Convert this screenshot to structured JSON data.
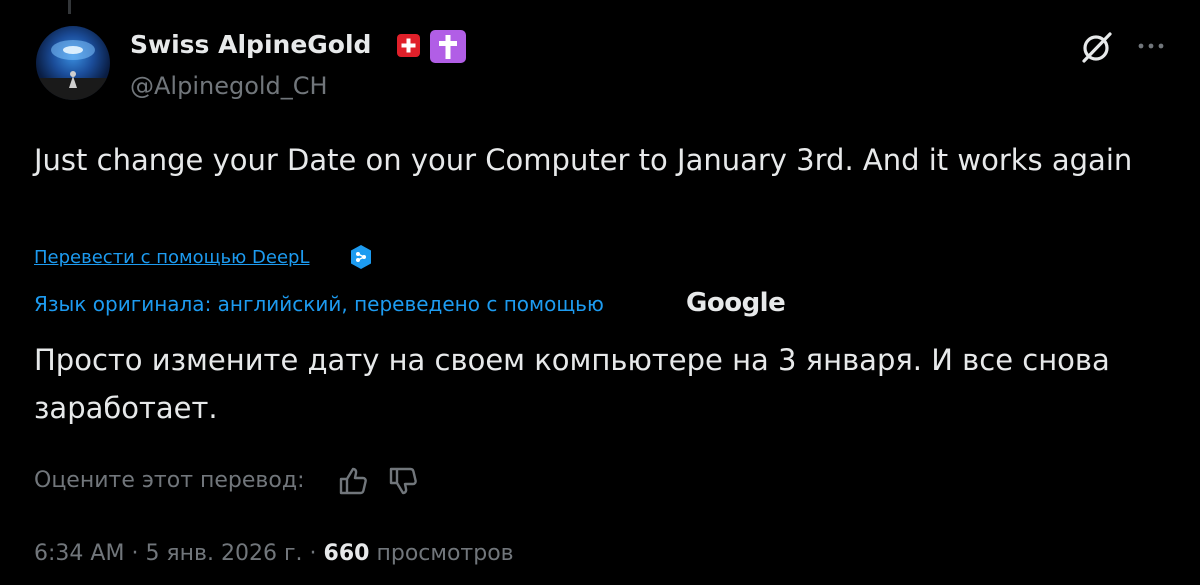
{
  "tweet": {
    "author": {
      "display_name": "Swiss AlpineGold",
      "handle": "@Alpinegold_CH",
      "flag_emoji": "swiss-flag-icon",
      "cross_emoji": "latin-cross-icon"
    },
    "text": "Just change your Date on your Computer to January 3rd. And it works again",
    "translate_link": "Перевести с помощью DeepL",
    "translation": {
      "source_label": "Язык оригинала: английский, переведено с помощью",
      "provider": "Google",
      "text": "Просто измените дату на своем компьютере на 3 января. И все снова заработает."
    },
    "rate": {
      "label": "Оцените этот перевод:"
    },
    "meta": {
      "time": "6:34 AM",
      "separator": "·",
      "date": "5 янв. 2026 г.",
      "views": "660",
      "views_label": "просмотров"
    }
  },
  "colors": {
    "background": "#000000",
    "text_primary": "#e7e9ea",
    "text_secondary": "#71767b",
    "link": "#1d9bf0",
    "flag_red": "#e0202a",
    "cross_purple": "#b15ee6"
  },
  "icons": [
    "grok-icon",
    "more-icon",
    "deepl-icon",
    "thumbs-up-icon",
    "thumbs-down-icon"
  ]
}
